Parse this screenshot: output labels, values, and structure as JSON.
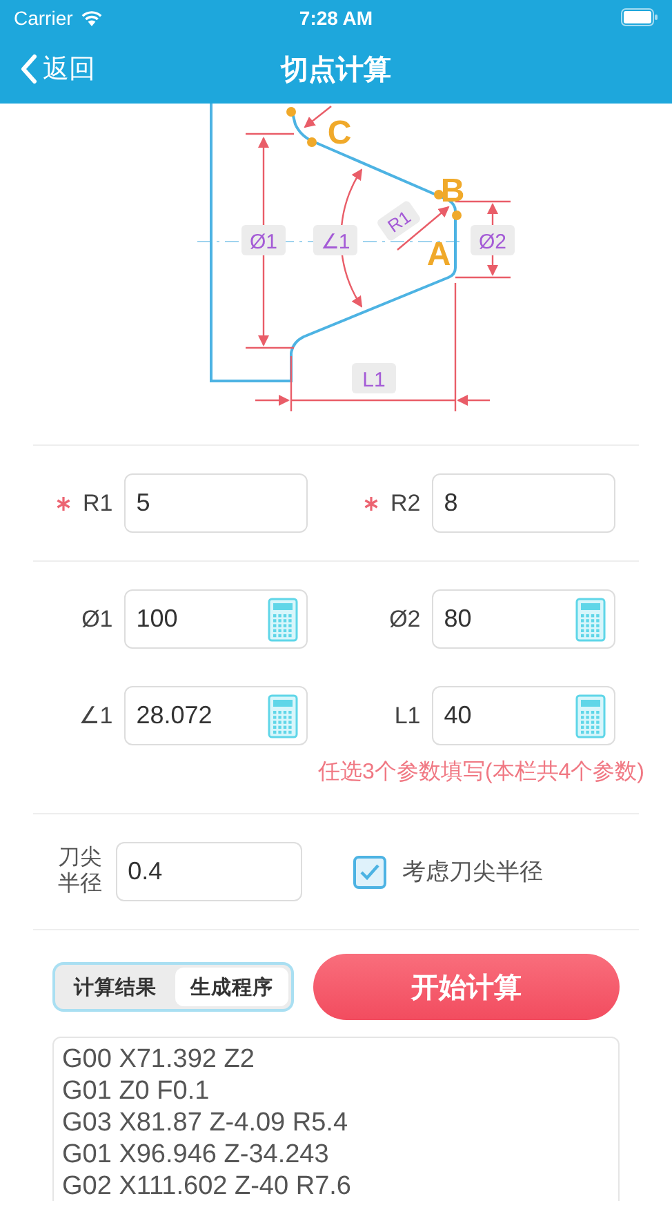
{
  "status_bar": {
    "carrier": "Carrier",
    "time": "7:28 AM"
  },
  "nav": {
    "back": "返回",
    "title": "切点计算"
  },
  "diagram": {
    "labels": [
      {
        "kind": "dim",
        "text": "Ø1"
      },
      {
        "kind": "dim",
        "text": "∠1"
      },
      {
        "kind": "radius",
        "text": "R1"
      },
      {
        "kind": "dim",
        "text": "Ø2"
      },
      {
        "kind": "dim",
        "text": "L1"
      },
      {
        "kind": "point",
        "text": "A"
      },
      {
        "kind": "point",
        "text": "B"
      },
      {
        "kind": "point",
        "text": "C"
      }
    ]
  },
  "required_fields": [
    {
      "label": "R1",
      "value": "5",
      "required": true,
      "calculator": false
    },
    {
      "label": "R2",
      "value": "8",
      "required": true,
      "calculator": false
    }
  ],
  "dimension_fields": [
    {
      "label": "Ø1",
      "value": "100",
      "required": false,
      "calculator": true
    },
    {
      "label": "Ø2",
      "value": "80",
      "required": false,
      "calculator": true
    },
    {
      "label": "∠1",
      "value": "28.072",
      "required": false,
      "calculator": true
    },
    {
      "label": "L1",
      "value": "40",
      "required": false,
      "calculator": true
    }
  ],
  "hint": "任选3个参数填写(本栏共4个参数)",
  "tool_tip": {
    "label": "刀尖半径",
    "value": "0.4",
    "checkbox": {
      "label": "考虑刀尖半径",
      "checked": true
    }
  },
  "segments": [
    {
      "label": "计算结果",
      "selected": false
    },
    {
      "label": "生成程序",
      "selected": true
    }
  ],
  "start_button": "开始计算",
  "program_lines": [
    "G00 X71.392 Z2",
    "G01 Z0 F0.1",
    "G03 X81.87 Z-4.09 R5.4",
    "G01 X96.946 Z-34.243",
    "G02 X111.602 Z-40 R7.6"
  ]
}
